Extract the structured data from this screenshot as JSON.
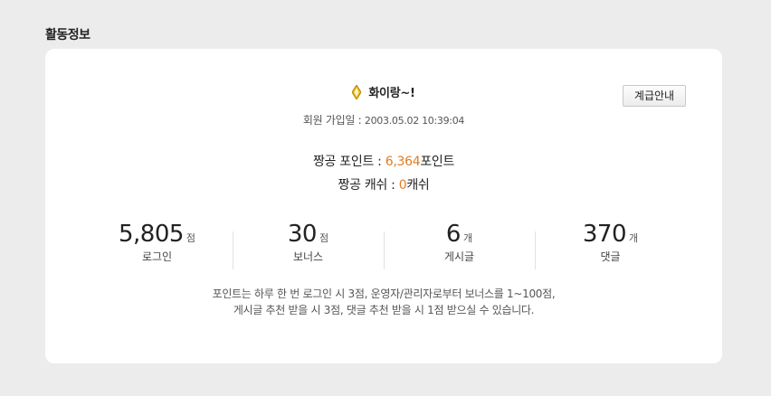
{
  "section": {
    "title": "활동정보"
  },
  "profile": {
    "rank_icon": "yellow-diamond-icon",
    "nickname": "화이랑~!",
    "join_label": "회원 가입일 : ",
    "join_date": "2003.05.02 10:39:04",
    "grade_button_label": "계급안내"
  },
  "points": {
    "point_label": "짱공 포인트 : ",
    "point_value": "6,364",
    "point_unit": "포인트",
    "cash_label": "짱공 캐쉬 : ",
    "cash_value": "0",
    "cash_unit": "캐쉬"
  },
  "stats": [
    {
      "value": "5,805",
      "unit": "점",
      "label": "로그인"
    },
    {
      "value": "30",
      "unit": "점",
      "label": "보너스"
    },
    {
      "value": "6",
      "unit": "개",
      "label": "게시글"
    },
    {
      "value": "370",
      "unit": "개",
      "label": "댓글"
    }
  ],
  "notice": {
    "line1": "포인트는 하루 한 번 로그인 시 3점, 운영자/관리자로부터 보너스를 1~100점,",
    "line2": "게시글 추천 받을 시 3점, 댓글 추천 받을 시 1점 받으실 수 있습니다."
  },
  "colors": {
    "accent": "#e07c22",
    "rank_icon": "#e8b923",
    "background": "#ececec",
    "card": "#ffffff"
  }
}
